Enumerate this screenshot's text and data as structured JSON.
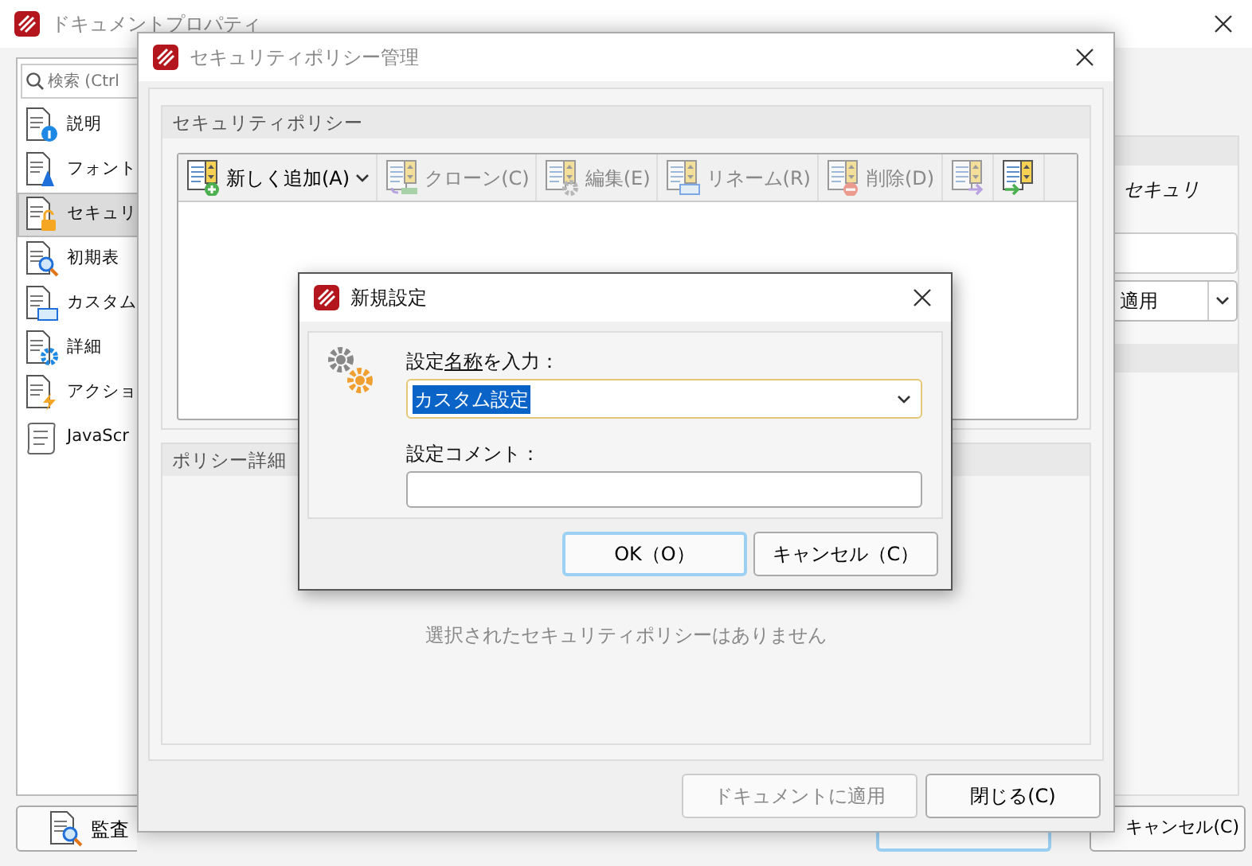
{
  "background_window": {
    "title": "ドキュメントプロパティ",
    "active": false,
    "search": {
      "placeholder": "検索 (Ctrl"
    },
    "sidebar": [
      {
        "label": "説明",
        "selected": false
      },
      {
        "label": "フォント",
        "selected": false
      },
      {
        "label": "セキュリ",
        "selected": true
      },
      {
        "label": "初期表",
        "selected": false
      },
      {
        "label": "カスタム",
        "selected": false
      },
      {
        "label": "詳細",
        "selected": false
      },
      {
        "label": "アクショ",
        "selected": false
      },
      {
        "label": "JavaScr",
        "selected": false
      }
    ],
    "right_panel": {
      "heading": "セキュリ",
      "apply_combo": "適用"
    },
    "audit_button": "監査",
    "cancel_button": "キャンセル(C)"
  },
  "policy_window": {
    "title": "セキュリティポリシー管理",
    "active": false,
    "group_title": "セキュリティポリシー",
    "toolbar": [
      {
        "label": "新しく追加(A)",
        "disabled": false,
        "dropdown": true
      },
      {
        "label": "クローン(C)",
        "disabled": true
      },
      {
        "label": "編集(E)",
        "disabled": true
      },
      {
        "label": "リネーム(R)",
        "disabled": true
      },
      {
        "label": "削除(D)",
        "disabled": true
      },
      {
        "disabled": true
      },
      {
        "disabled": false
      }
    ],
    "details_title": "ポリシー詳細",
    "empty_message": "選択されたセキュリティポリシーはありません",
    "buttons": [
      {
        "label": "ドキュメントに適用",
        "disabled": true
      },
      {
        "label": "閉じる(C)",
        "disabled": false
      }
    ]
  },
  "new_setting_dialog": {
    "title": "新規設定",
    "active": true,
    "name_label": {
      "before": "設定",
      "access_key": "名称",
      "after": "を入力："
    },
    "name_value": "カスタム設定",
    "comment_label": "設定コメント：",
    "buttons": [
      {
        "label": "OK（O）",
        "default": true
      },
      {
        "label": "キャンセル（C）",
        "default": false
      }
    ]
  }
}
